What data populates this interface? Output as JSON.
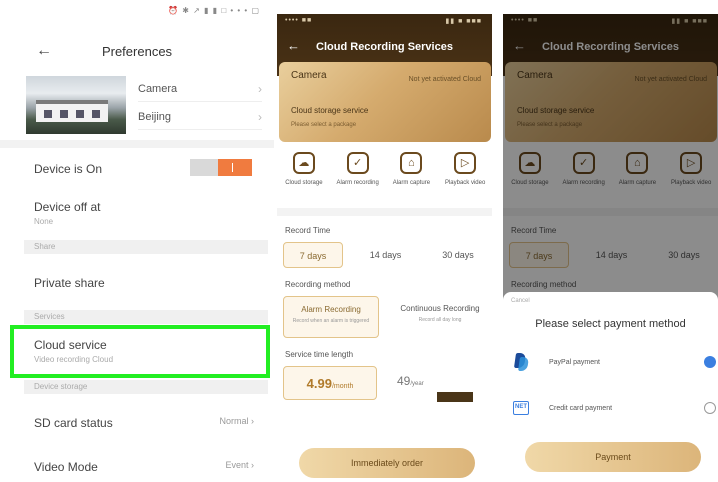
{
  "prefs": {
    "status_bar": "⏰ ✱ ↗ ▮ ▮ □ • • • ▢",
    "back_icon": "←",
    "title": "Preferences",
    "camera_rows": [
      {
        "label": "Camera",
        "chev": "›"
      },
      {
        "label": "Beijing",
        "chev": "›"
      }
    ],
    "device_on": {
      "label": "Device is On",
      "enabled": true
    },
    "device_off": {
      "label": "Device off at",
      "sub": "None"
    },
    "section_share": "Share",
    "private_share": "Private share",
    "section_service": "Services",
    "cloud_service": {
      "label": "Cloud service",
      "sub": "Video recording Cloud"
    },
    "section_storage": "Device storage",
    "sd_card": {
      "label": "SD card status",
      "value": "Normal ›"
    },
    "video_mode": {
      "label": "Video Mode",
      "value": "Event ›"
    }
  },
  "cloud": {
    "status_left": "•••• ■■",
    "status_right": "▮▮ ■ ■■■",
    "back_icon": "←",
    "title": "Cloud Recording Services",
    "card": {
      "camera": "Camera",
      "right": "Not yet activated Cloud",
      "desc": "Cloud storage service",
      "small": "Please select a package"
    },
    "features": [
      {
        "icon": "☁",
        "label": "Cloud storage"
      },
      {
        "icon": "✓",
        "label": "Alarm recording"
      },
      {
        "icon": "⌂",
        "label": "Alarm capture"
      },
      {
        "icon": "▷",
        "label": "Playback video"
      }
    ],
    "record_time_label": "Record Time",
    "record_times": [
      "7 days",
      "14 days",
      "30 days"
    ],
    "recording_method_label": "Recording method",
    "methods": [
      {
        "name": "Alarm Recording",
        "desc": "Record when an alarm is triggered"
      },
      {
        "name": "Continuous Recording",
        "desc": "Record all day long"
      }
    ],
    "service_label": "Service time length",
    "prices": [
      {
        "amount": "4.99",
        "unit": "/month"
      },
      {
        "amount": "49",
        "unit": "/year"
      }
    ],
    "button": "Immediately order"
  },
  "payment": {
    "close": "Cancel",
    "title": "Please select payment method",
    "methods": [
      {
        "name": "PayPal payment",
        "selected": true
      },
      {
        "name": "Credit card payment",
        "selected": false
      }
    ],
    "card_icon_text": "NET",
    "button": "Payment"
  },
  "colors": {
    "accent_orange": "#f07b3f",
    "highlight": "#22ee22",
    "gold": "#dcb57a",
    "radio": "#3b7fe0"
  }
}
